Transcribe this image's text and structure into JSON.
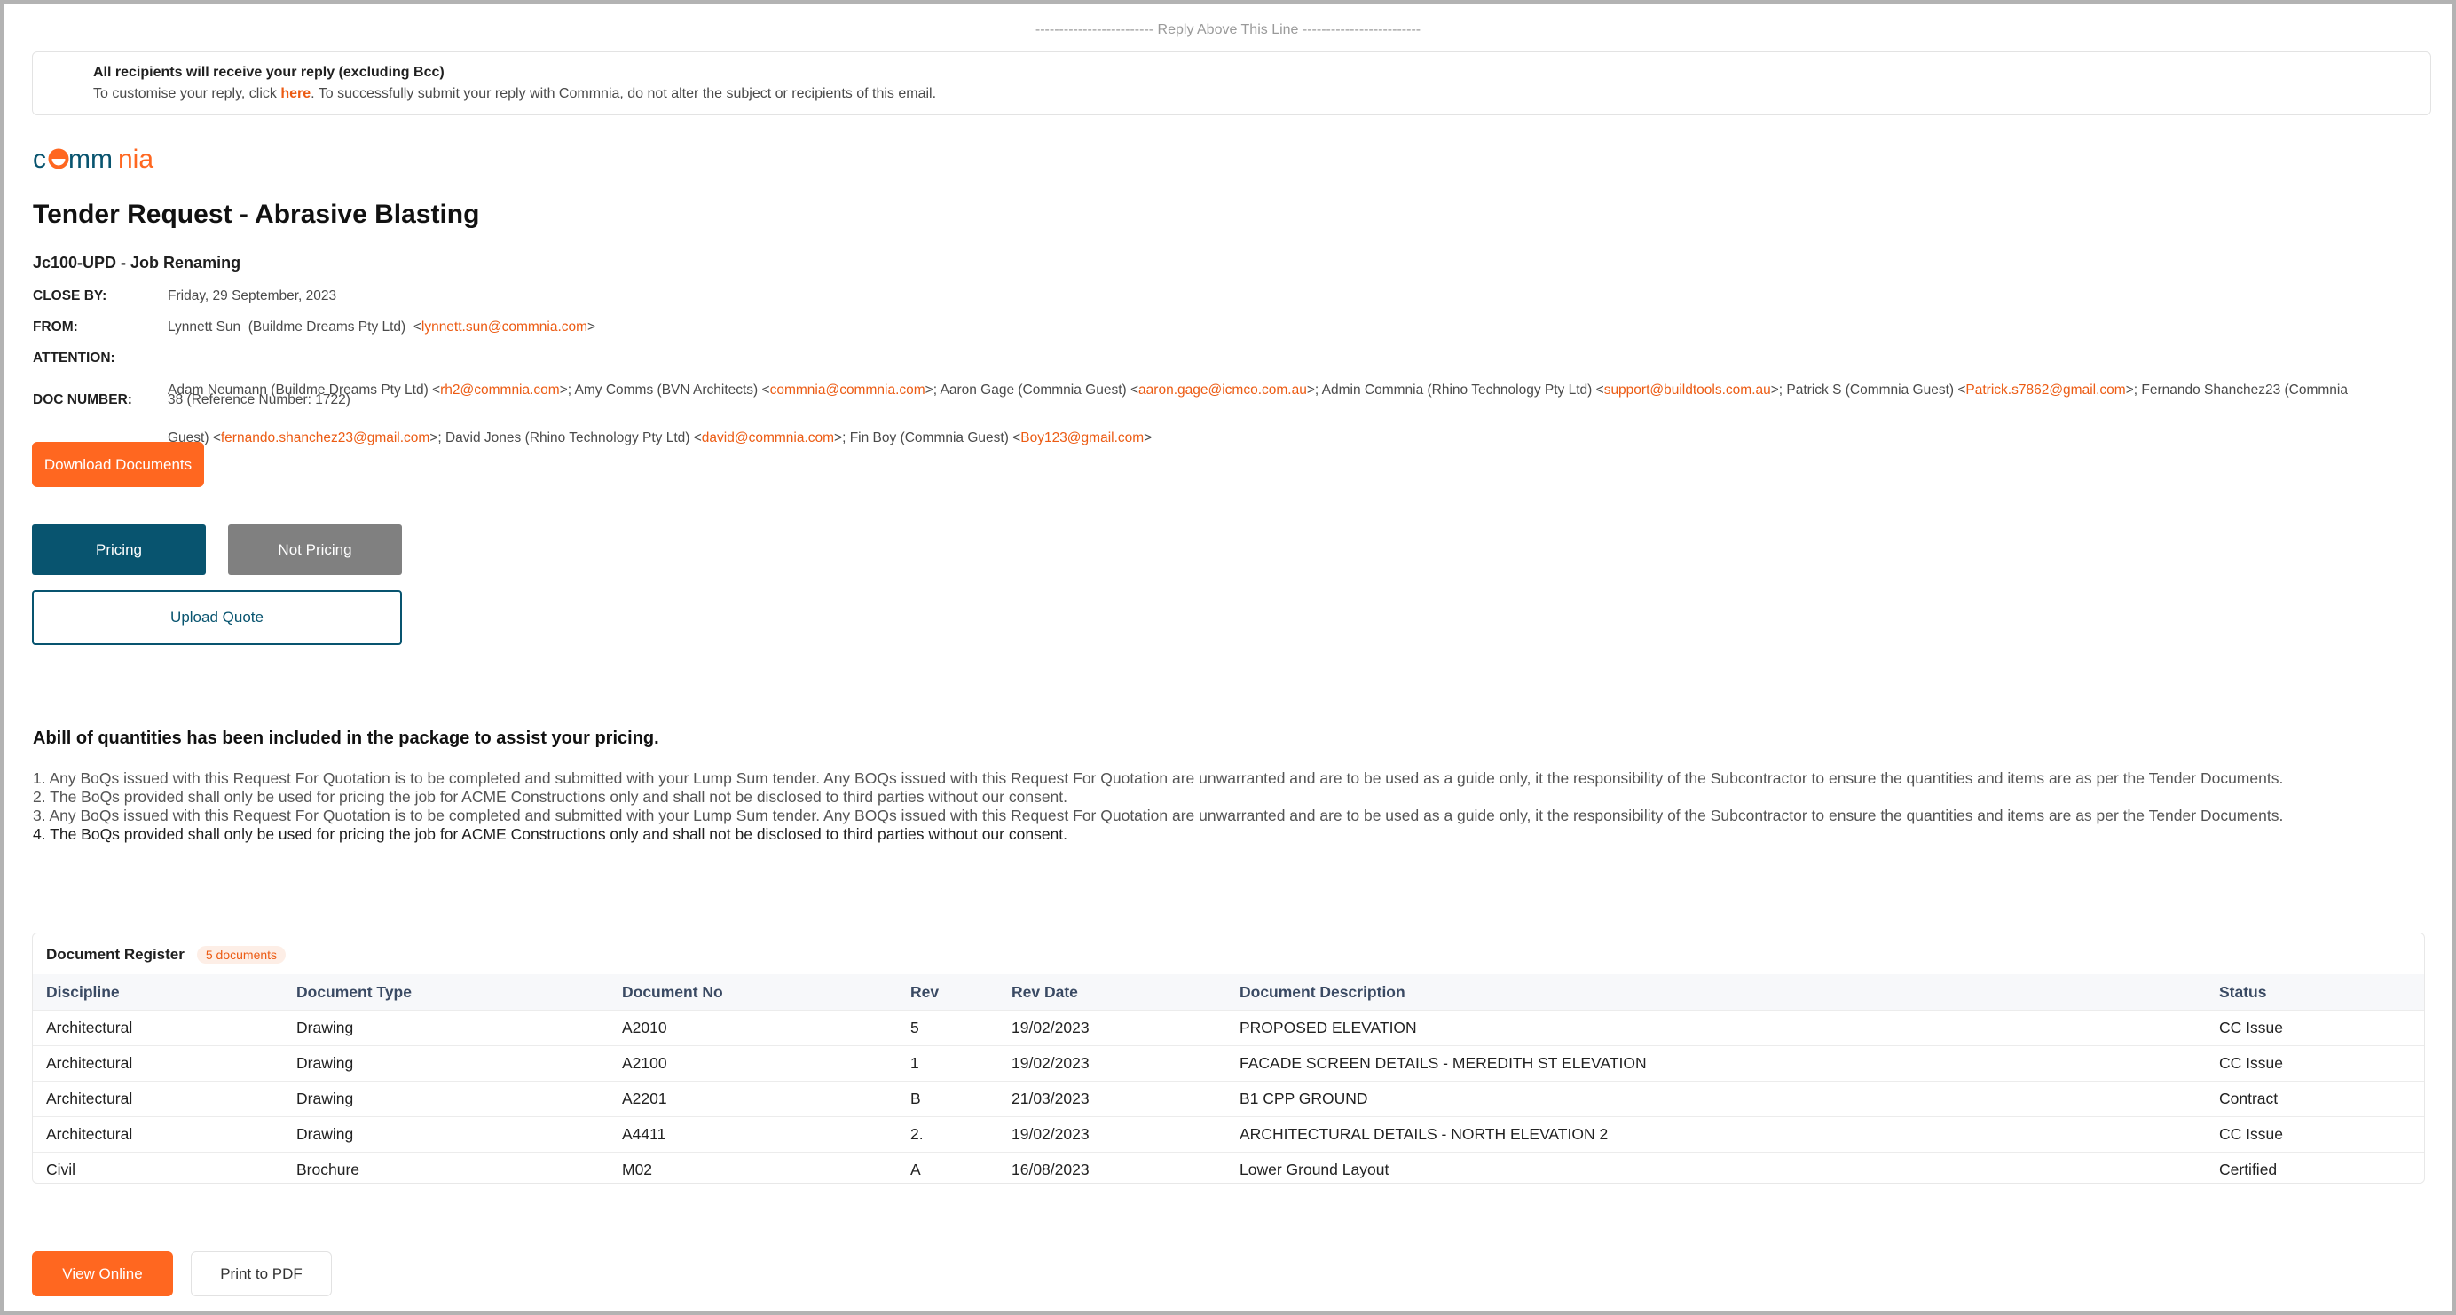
{
  "reply_line": "------------------------- Reply Above This Line -------------------------",
  "notice": {
    "title": "All recipients will receive your reply (excluding Bcc)",
    "text_before": "To customise your reply, click ",
    "link": "here",
    "text_after": ". To successfully submit your reply with Commnia, do not alter the subject or recipients of this email."
  },
  "brand": {
    "logo_icon": "commnia-logo",
    "colors": {
      "accent": "#ff6720",
      "primary": "#08546f"
    }
  },
  "title": "Tender Request - Abrasive Blasting",
  "job": "Jc100-UPD - Job Renaming",
  "meta": {
    "close_by_label": "CLOSE BY:",
    "close_by_value": "Friday, 29 September, 2023",
    "from_label": "FROM:",
    "from_name": "Lynnett Sun  (Buildme Dreams Pty Ltd)  <",
    "from_email": "lynnett.sun@commnia.com",
    "attention_label": "ATTENTION:",
    "attention": [
      {
        "name": "Adam Neumann (Buildme Dreams Pty Ltd)  <",
        "email": "rh2@commnia.com"
      },
      {
        "name": ">;  Amy Comms (BVN Architects)  <",
        "email": "commnia@commnia.com"
      },
      {
        "name": ">;  Aaron Gage (Commnia Guest)  <",
        "email": "aaron.gage@icmco.com.au"
      },
      {
        "name": ">;  Admin Commnia (Rhino Technology Pty Ltd)  <",
        "email": "support@buildtools.com.au"
      },
      {
        "name": ">;  Patrick S (Commnia Guest)  <",
        "email": "Patrick.s7862@gmail.com"
      },
      {
        "name": ">;  Fernando Shanchez23 (Commnia",
        "email": ""
      }
    ],
    "attention_line2": [
      {
        "name": "Guest)  <",
        "email": "fernando.shanchez23@gmail.com"
      },
      {
        "name": ">;  David Jones (Rhino Technology Pty Ltd)  <",
        "email": "david@commnia.com"
      },
      {
        "name": ">;  Fin Boy (Commnia Guest)  <",
        "email": "Boy123@gmail.com"
      },
      {
        "name": ">",
        "email": ""
      }
    ],
    "doc_number_label": "DOC NUMBER:",
    "doc_number_value": "38 (Reference Number: 1722)"
  },
  "buttons": {
    "download": "Download Documents",
    "pricing": "Pricing",
    "not_pricing": "Not Pricing",
    "upload": "Upload Quote",
    "view_online": "View Online",
    "print_pdf": "Print to PDF"
  },
  "boq": {
    "heading": "Abill of quantities has been included in the package to assist your pricing.",
    "items": [
      "1. Any BoQs issued with this Request For Quotation is to be completed and submitted with your Lump Sum tender. Any BOQs issued with this Request For Quotation are unwarranted and are to be used as a guide only, it the responsibility of the Subcontractor to ensure the quantities and items are as per the Tender Documents.",
      "2. The BoQs provided shall only be used for pricing the job for ACME Constructions only and shall not be disclosed to third parties without our consent.",
      "3. Any BoQs issued with this Request For Quotation is to be completed and submitted with your Lump Sum tender. Any BOQs issued with this Request For Quotation are unwarranted and are to be used as a guide only, it the responsibility of the Subcontractor to ensure the quantities and items are as per the Tender Documents.",
      "4. The BoQs provided shall only be used for pricing the job for ACME Constructions only and shall not be disclosed to third parties without our consent."
    ]
  },
  "register": {
    "title": "Document Register",
    "badge": "5 documents",
    "columns": [
      "Discipline",
      "Document Type",
      "Document No",
      "Rev",
      "Rev Date",
      "Document Description",
      "Status"
    ],
    "rows": [
      [
        "Architectural",
        "Drawing",
        "A2010",
        "5",
        "19/02/2023",
        "PROPOSED ELEVATION",
        "CC Issue"
      ],
      [
        "Architectural",
        "Drawing",
        "A2100",
        "1",
        "19/02/2023",
        "FACADE SCREEN DETAILS - MEREDITH ST ELEVATION",
        "CC Issue"
      ],
      [
        "Architectural",
        "Drawing",
        "A2201",
        "B",
        "21/03/2023",
        "B1 CPP GROUND",
        "Contract"
      ],
      [
        "Architectural",
        "Drawing",
        "A4411",
        "2.",
        "19/02/2023",
        "ARCHITECTURAL DETAILS - NORTH ELEVATION 2",
        "CC Issue"
      ],
      [
        "Civil",
        "Brochure",
        "M02",
        "A",
        "16/08/2023",
        "Lower Ground Layout",
        "Certified"
      ]
    ]
  }
}
